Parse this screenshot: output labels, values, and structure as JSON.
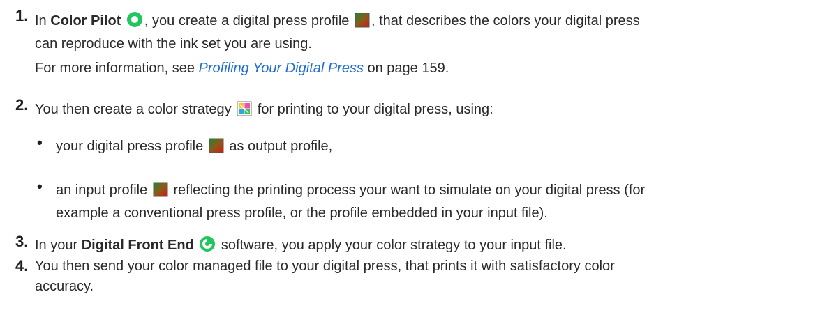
{
  "steps": [
    {
      "number": "1.",
      "text_a": "In ",
      "app_name": "Color Pilot",
      "text_b": ", you create a digital press profile ",
      "text_c": ", that describes the colors your digital press",
      "text_d": "can reproduce with the ink set you are using.",
      "info_prefix": "For more information, see ",
      "info_link": "Profiling Your Digital Press",
      "info_suffix": " on page 159."
    },
    {
      "number": "2.",
      "text_a": "You then create a color strategy ",
      "text_b": " for printing to your digital press, using:",
      "bullets": [
        {
          "symbol": "•",
          "text_a": "your digital press profile ",
          "text_b": " as output profile,"
        },
        {
          "symbol": "•",
          "text_a": "an input profile ",
          "text_b": " reflecting the printing process your want to simulate on your digital press (for",
          "text_c": "example a conventional press profile, or the profile embedded in your input file)."
        }
      ]
    },
    {
      "number": "3.",
      "text_a": "In your ",
      "app_name": "Digital Front End",
      "text_b": " software, you apply your color strategy to your input file."
    },
    {
      "number": "4.",
      "text_a": "You then send your color managed file to your digital press, that prints it with satisfactory color",
      "text_b": "accuracy."
    }
  ],
  "icons": {
    "color_pilot": "color-pilot-app-icon",
    "press_profile": "profile-icon",
    "color_strategy": "color-strategy-icon",
    "dfe": "digital-front-end-app-icon"
  },
  "colors": {
    "link": "#1f6fd0",
    "app_green": "#22c55e"
  }
}
